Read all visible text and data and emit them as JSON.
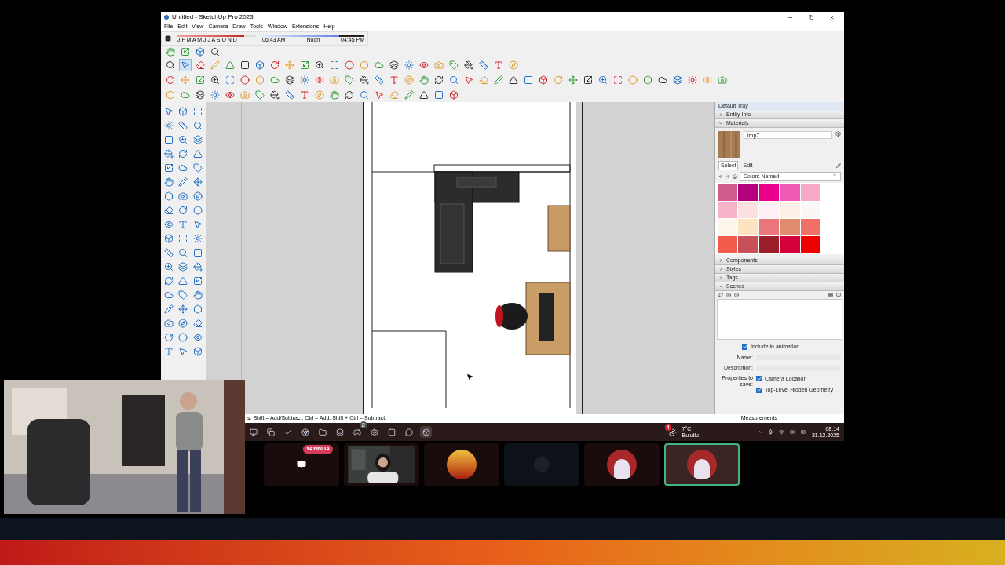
{
  "window": {
    "title": "Untitled - SketchUp Pro 2023"
  },
  "menu": [
    "File",
    "Edit",
    "View",
    "Camera",
    "Draw",
    "Tools",
    "Window",
    "Extensions",
    "Help"
  ],
  "shadows": {
    "months": "J F M A M J J A S O N D",
    "time_start": "06:43 AM",
    "time_mid": "Noon",
    "time_end": "04:45 PM"
  },
  "main_toolbar": [
    {
      "selected": false
    },
    {
      "selected": true
    },
    {
      "selected": false
    },
    {
      "selected": false
    },
    {
      "selected": false
    },
    {
      "selected": false
    },
    {
      "selected": false
    },
    {
      "selected": false
    },
    {
      "selected": false
    },
    {
      "selected": false
    },
    {
      "selected": false
    },
    {
      "selected": false
    },
    {
      "selected": false
    },
    {
      "selected": false
    },
    {
      "selected": false
    },
    {
      "selected": false
    },
    {
      "selected": false
    },
    {
      "selected": false
    },
    {
      "selected": false
    },
    {
      "selected": false
    },
    {
      "selected": false
    },
    {
      "selected": false
    },
    {
      "selected": false
    },
    {
      "selected": false
    }
  ],
  "tray": {
    "title": "Default Tray",
    "panels_top": [
      {
        "label": "Entity Info",
        "expanded": false
      },
      {
        "label": "Materials",
        "expanded": true
      }
    ],
    "material_name": "imp7",
    "tabs": [
      {
        "label": "Select",
        "selected": true
      },
      {
        "label": "Edit",
        "selected": false
      }
    ],
    "collection": "Colors-Named",
    "swatches": [
      {
        "color": "#d35c8f"
      },
      {
        "color": "#b5007d"
      },
      {
        "color": "#e8008c"
      },
      {
        "color": "#ee5ab4"
      },
      {
        "color": "#f7a8c6"
      },
      {
        "color": "#f7b4c8"
      },
      {
        "color": "#fde0e0"
      },
      {
        "color": "#fdf0f5"
      },
      {
        "color": "#fbf0e6"
      },
      {
        "color": "#fbf7f5"
      },
      {
        "color": "#fdf6ea"
      },
      {
        "color": "#fde3c2"
      },
      {
        "color": "#e8767a"
      },
      {
        "color": "#e08a6e"
      },
      {
        "color": "#ee7066"
      },
      {
        "color": "#f35b4a"
      },
      {
        "color": "#c8505a"
      },
      {
        "color": "#9b1e2b"
      },
      {
        "color": "#d4003a"
      },
      {
        "color": "#ee0000"
      }
    ],
    "panels_bottom": [
      {
        "label": "Components",
        "expanded": false
      },
      {
        "label": "Styles",
        "expanded": false
      },
      {
        "label": "Tags",
        "expanded": false
      },
      {
        "label": "Scenes",
        "expanded": true
      }
    ],
    "scenes": {
      "include_label": "Include in animation",
      "include_checked": true,
      "name_label": "Name:",
      "description_label": "Description:",
      "properties_label": "Properties to save:",
      "properties": [
        {
          "label": "Camera Location",
          "checked": true
        },
        {
          "label": "Top-Level Hidden Geometry",
          "checked": true
        }
      ]
    }
  },
  "status_bar": {
    "hint": "s. Shift = Add/Subtract. Ctrl = Add. Shift + Ctrl = Subtract.",
    "measurements": "Measurements"
  },
  "taskbar": {
    "apps": [
      {
        "selected": false
      },
      {
        "selected": false
      },
      {
        "selected": false
      },
      {
        "selected": false
      },
      {
        "selected": false
      },
      {
        "selected": false
      },
      {
        "selected": false,
        "badge": "2"
      },
      {
        "selected": false
      },
      {
        "selected": false
      },
      {
        "selected": false
      },
      {
        "selected": true
      }
    ],
    "weather_badge": "4",
    "temperature": "7°C",
    "weather": "Bulutlu",
    "time": "08:14",
    "date": "31.12.2025"
  },
  "call": {
    "live_badge": "YAYINDA",
    "tiles": [
      {
        "kind": "screen",
        "speaking": false
      },
      {
        "kind": "picture",
        "speaking": false
      },
      {
        "kind": "ball",
        "speaking": false
      },
      {
        "kind": "dark",
        "speaking": false
      },
      {
        "kind": "avatar",
        "speaking": false
      },
      {
        "kind": "avatar",
        "speaking": true
      }
    ]
  }
}
